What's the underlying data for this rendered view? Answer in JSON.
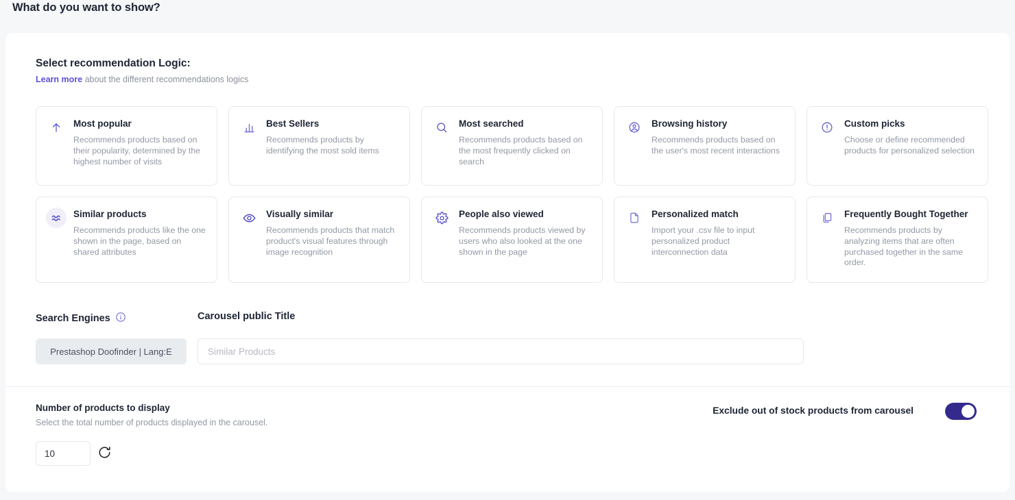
{
  "page": {
    "heading": "What do you want to show?"
  },
  "logic_section": {
    "title": "Select recommendation Logic:",
    "link_label": "Learn more",
    "sub_text": " about the different recommendations logics",
    "cards": [
      {
        "icon": "arrow-up-icon",
        "title": "Most popular",
        "desc": "Recommends products based on their popularity, determined by the highest number of visits",
        "selected": false
      },
      {
        "icon": "bar-chart-icon",
        "title": "Best Sellers",
        "desc": "Recommends products by identifying the most sold items",
        "selected": false
      },
      {
        "icon": "search-icon",
        "title": "Most searched",
        "desc": "Recommends products based on the most frequently clicked on search",
        "selected": false
      },
      {
        "icon": "user-circle-icon",
        "title": "Browsing history",
        "desc": "Recommends products based on the user's most recent interactions",
        "selected": false
      },
      {
        "icon": "exclamation-circle-icon",
        "title": "Custom picks",
        "desc": "Choose or define recommended products for personalized selection",
        "selected": false
      },
      {
        "icon": "approximately-equal-icon",
        "title": "Similar products",
        "desc": "Recommends products like the one shown in the page, based on shared attributes",
        "selected": true
      },
      {
        "icon": "eye-icon",
        "title": "Visually similar",
        "desc": "Recommends products that match product's visual features through image recognition",
        "selected": false
      },
      {
        "icon": "gear-icon",
        "title": "People also viewed",
        "desc": "Recommends products viewed by users who also looked at the one shown in the page",
        "selected": false
      },
      {
        "icon": "file-icon",
        "title": "Personalized match",
        "desc": "Import your .csv file to input personalized product interconnection data",
        "selected": false
      },
      {
        "icon": "copy-icon",
        "title": "Frequently Bought Together",
        "desc": "Recommends products by analyzing items that are often purchased together in the same order.",
        "selected": false
      }
    ]
  },
  "engines": {
    "label": "Search Engines",
    "info_icon": "info-icon",
    "selected_value": "Prestashop Doofinder | Lang:E"
  },
  "carousel_title": {
    "label": "Carousel public Title",
    "value": "",
    "placeholder": "Similar Products"
  },
  "products_count": {
    "title": "Number of products to display",
    "description": "Select the total number of products displayed in the carousel.",
    "value": "10",
    "refresh_icon": "refresh-icon"
  },
  "exclude_stock": {
    "label": "Exclude out of stock products from carousel",
    "enabled": true
  },
  "colors": {
    "accent": "#5b53d6",
    "toggle_on": "#332a8c",
    "icon": "#5650cc",
    "page_bg": "#f6f7f9",
    "panel_bg": "#ffffff",
    "border": "#e6e8ed",
    "text": "#1d2433",
    "muted": "#9298a4"
  }
}
